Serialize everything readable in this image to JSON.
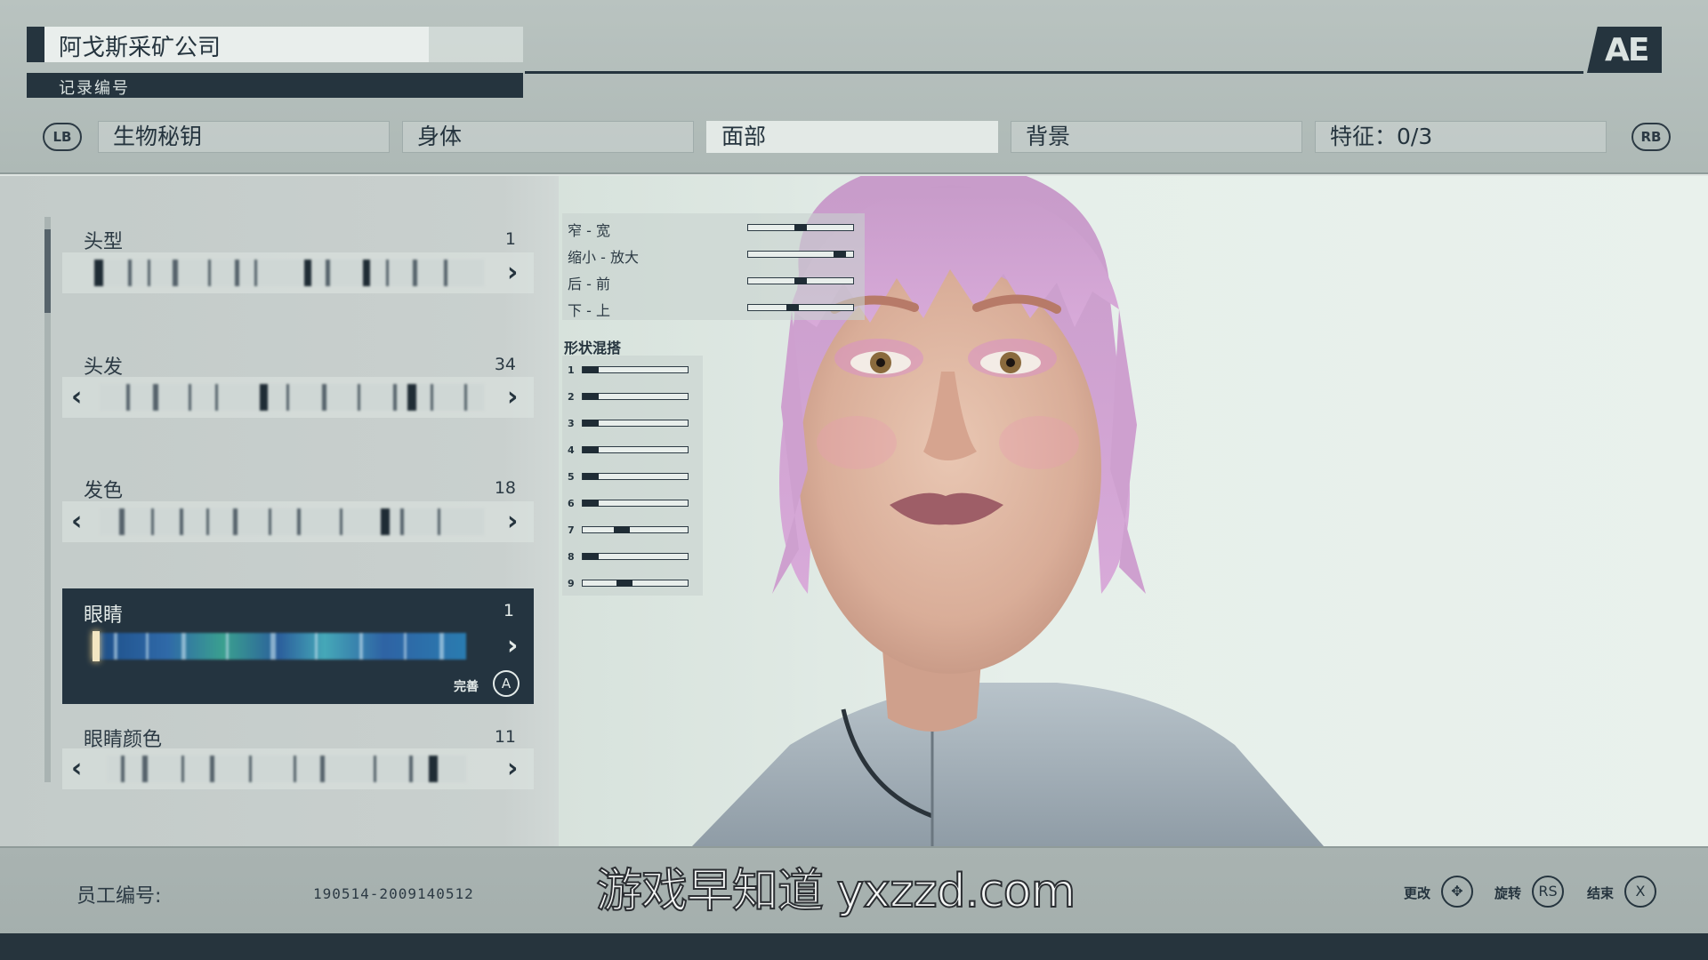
{
  "header": {
    "company": "阿戈斯采矿公司",
    "record_label": "记录编号",
    "logo_text": "AE"
  },
  "tabs": {
    "lb": "LB",
    "rb": "RB",
    "items": [
      "生物秘钥",
      "身体",
      "面部",
      "背景",
      "特征：0/3"
    ],
    "active_index": 2
  },
  "categories": [
    {
      "label": "头型",
      "value": "1"
    },
    {
      "label": "头发",
      "value": "34"
    },
    {
      "label": "发色",
      "value": "18"
    },
    {
      "label": "眼睛",
      "value": "1",
      "selected": true,
      "action_label": "完善",
      "action_button": "A"
    },
    {
      "label": "眼睛颜色",
      "value": "11"
    }
  ],
  "sliders": [
    {
      "label": "窄 - 宽",
      "value": 0.5
    },
    {
      "label": "缩小 - 放大",
      "value": 0.92
    },
    {
      "label": "后 - 前",
      "value": 0.5
    },
    {
      "label": "下 - 上",
      "value": 0.41
    }
  ],
  "blend": {
    "title": "形状混搭",
    "items": [
      {
        "label": "1",
        "value": 0.0
      },
      {
        "label": "2",
        "value": 0.0
      },
      {
        "label": "3",
        "value": 0.0
      },
      {
        "label": "4",
        "value": 0.0
      },
      {
        "label": "5",
        "value": 0.0
      },
      {
        "label": "6",
        "value": 0.0
      },
      {
        "label": "7",
        "value": 0.35
      },
      {
        "label": "8",
        "value": 0.0
      },
      {
        "label": "9",
        "value": 0.38
      }
    ]
  },
  "footer": {
    "employee_label": "员工编号:",
    "employee_id": "190514-2009140512",
    "watermark": "游戏早知道 yxzzd.com",
    "hints": [
      {
        "label": "更改",
        "button": "✥"
      },
      {
        "label": "旋转",
        "button": "RS"
      },
      {
        "label": "结束",
        "button": "X"
      }
    ]
  },
  "colors": {
    "panel_dark": "#243440",
    "header_bg": "#b9c3c0",
    "hair_pink": "#d9a7d8"
  }
}
